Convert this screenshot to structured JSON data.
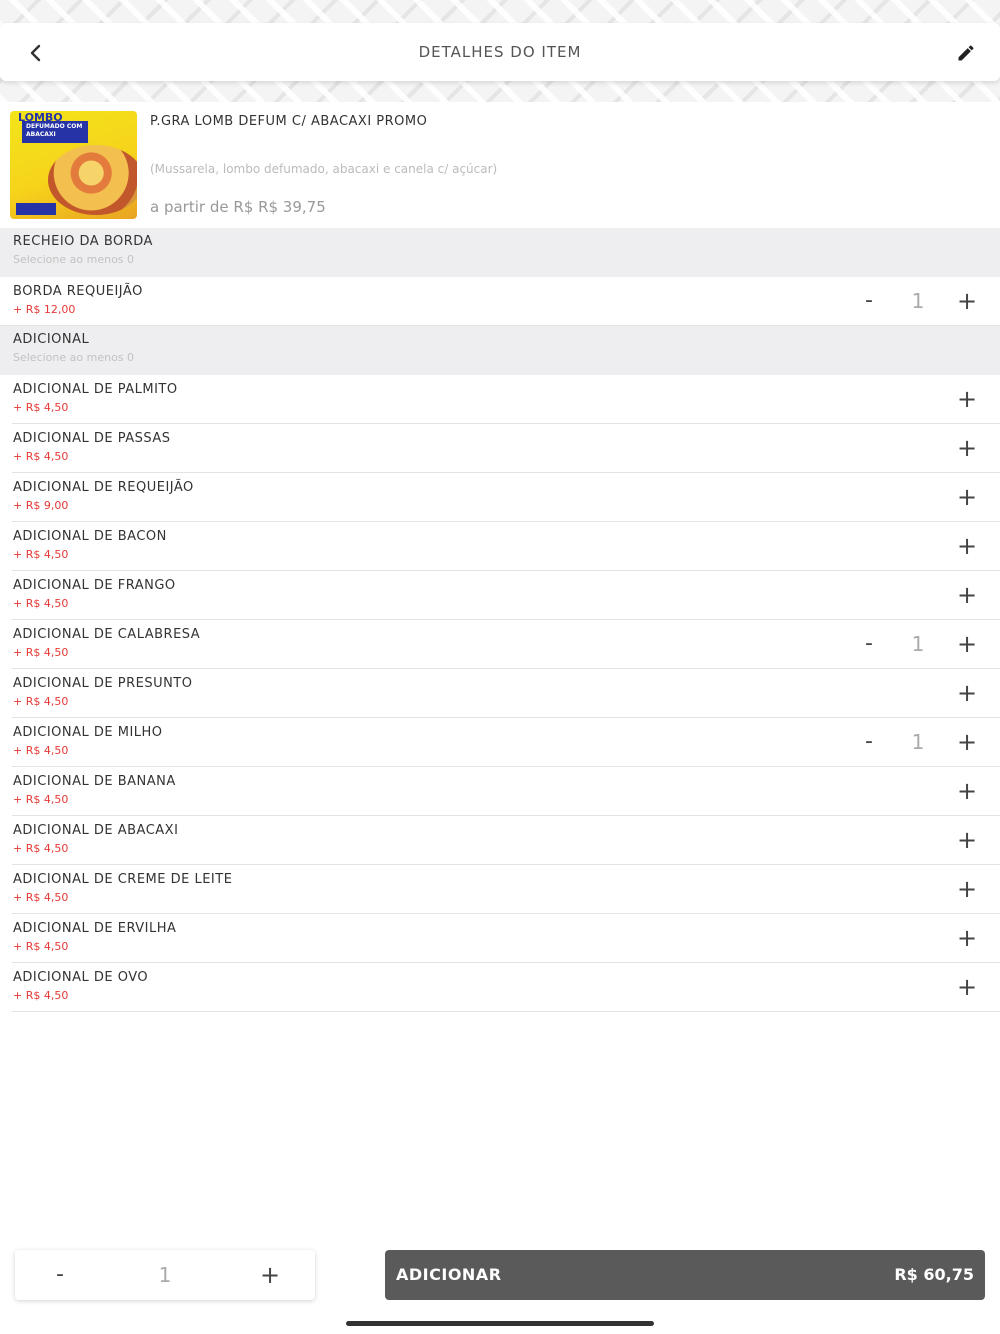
{
  "header": {
    "title": "DETALHES DO ITEM",
    "back_icon": "chevron-left-icon",
    "edit_icon": "pencil-icon"
  },
  "product": {
    "name": "P.GRA LOMB DEFUM C/ ABACAXI PROMO",
    "description": "(Mussarela, lombo defumado, abacaxi e canela c/ açúcar)",
    "price": "a partir de R$ R$ 39,75",
    "image": {
      "logo_text": "LOMBO",
      "banner_text": "DEFUMADO COM ABACAXI"
    }
  },
  "groups": [
    {
      "title": "RECHEIO DA BORDA",
      "subtitle": "Selecione ao menos 0",
      "items": [
        {
          "name": "BORDA REQUEIJÃO",
          "price": "+ R$ 12,00",
          "qty": "1"
        }
      ]
    },
    {
      "title": "ADICIONAL",
      "subtitle": "Selecione ao menos 0",
      "items": [
        {
          "name": "ADICIONAL DE PALMITO",
          "price": "+ R$ 4,50",
          "qty": ""
        },
        {
          "name": "ADICIONAL DE PASSAS",
          "price": "+ R$ 4,50",
          "qty": ""
        },
        {
          "name": "ADICIONAL DE REQUEIJÃO",
          "price": "+ R$ 9,00",
          "qty": ""
        },
        {
          "name": "ADICIONAL DE BACON",
          "price": "+ R$ 4,50",
          "qty": ""
        },
        {
          "name": "ADICIONAL DE FRANGO",
          "price": "+ R$ 4,50",
          "qty": ""
        },
        {
          "name": "ADICIONAL DE CALABRESA",
          "price": "+ R$ 4,50",
          "qty": "1"
        },
        {
          "name": "ADICIONAL DE PRESUNTO",
          "price": "+ R$ 4,50",
          "qty": ""
        },
        {
          "name": "ADICIONAL DE MILHO",
          "price": "+ R$ 4,50",
          "qty": "1"
        },
        {
          "name": "ADICIONAL DE BANANA",
          "price": "+ R$ 4,50",
          "qty": ""
        },
        {
          "name": "ADICIONAL DE ABACAXI",
          "price": "+ R$ 4,50",
          "qty": ""
        },
        {
          "name": "ADICIONAL DE CREME DE LEITE",
          "price": "+ R$ 4,50",
          "qty": ""
        },
        {
          "name": "ADICIONAL DE ERVILHA",
          "price": "+ R$ 4,50",
          "qty": ""
        },
        {
          "name": "ADICIONAL DE OVO",
          "price": "+ R$ 4,50",
          "qty": ""
        }
      ]
    }
  ],
  "stepper": {
    "minus_label": "-",
    "plus_label": "+"
  },
  "footer": {
    "qty": "1",
    "minus_label": "-",
    "plus_label": "+",
    "add_label": "ADICIONAR",
    "total": "R$ 60,75"
  },
  "colors": {
    "price_red": "#e53935",
    "button_dark": "#5a5a5a",
    "group_bg": "#eeeef0"
  }
}
